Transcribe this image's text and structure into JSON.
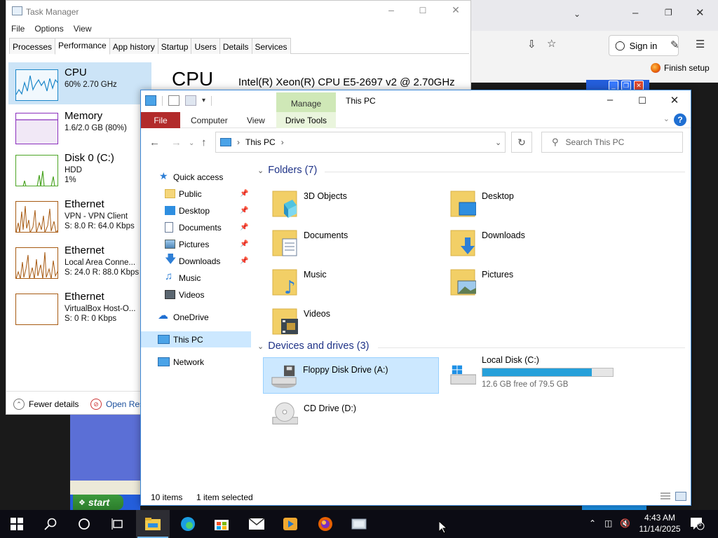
{
  "browser": {
    "sign_in": "Sign in",
    "finish_setup": "Finish setup"
  },
  "xp": {
    "start": "start"
  },
  "task_manager": {
    "title": "Task Manager",
    "menu": [
      "File",
      "Options",
      "View"
    ],
    "tabs": [
      "Processes",
      "Performance",
      "App history",
      "Startup",
      "Users",
      "Details",
      "Services"
    ],
    "active_tab": "Performance",
    "items": [
      {
        "name": "CPU",
        "lines": [
          "60%  2.70 GHz"
        ],
        "color": "#1c87c9",
        "selected": true
      },
      {
        "name": "Memory",
        "lines": [
          "1.6/2.0 GB (80%)"
        ],
        "color": "#8b2fbd",
        "selected": false
      },
      {
        "name": "Disk 0 (C:)",
        "lines": [
          "HDD",
          "1%"
        ],
        "color": "#4da526",
        "selected": false
      },
      {
        "name": "Ethernet",
        "lines": [
          "VPN - VPN Client",
          "S: 8.0  R: 64.0 Kbps"
        ],
        "color": "#a75a12",
        "selected": false
      },
      {
        "name": "Ethernet",
        "lines": [
          "Local Area Conne...",
          "S: 24.0  R: 88.0 Kbps"
        ],
        "color": "#a75a12",
        "selected": false
      },
      {
        "name": "Ethernet",
        "lines": [
          "VirtualBox Host-O...",
          "S: 0  R: 0 Kbps"
        ],
        "color": "#a75a12",
        "selected": false
      }
    ],
    "detail_title": "CPU",
    "cpu_model": "Intel(R) Xeon(R) CPU E5-2697 v2 @ 2.70GHz",
    "fewer_details": "Fewer details",
    "open_resource": "Open Res"
  },
  "explorer": {
    "title": "This PC",
    "manage_tab": "Manage",
    "ribbon_tabs": [
      "File",
      "Computer",
      "View"
    ],
    "drive_tools": "Drive Tools",
    "address": "This PC",
    "search_placeholder": "Search This PC",
    "nav": {
      "quick_access": "Quick access",
      "quick_items": [
        "Public",
        "Desktop",
        "Documents",
        "Pictures",
        "Downloads",
        "Music",
        "Videos"
      ],
      "onedrive": "OneDrive",
      "this_pc": "This PC",
      "network": "Network"
    },
    "folders_header": "Folders (7)",
    "folders": [
      "3D Objects",
      "Desktop",
      "Documents",
      "Downloads",
      "Music",
      "Pictures",
      "Videos"
    ],
    "devices_header": "Devices and drives (3)",
    "devices": [
      {
        "name": "Floppy Disk Drive (A:)",
        "selected": true
      },
      {
        "name": "Local Disk (C:)",
        "free": "12.6 GB free of 79.5 GB",
        "used_fraction": 0.84
      },
      {
        "name": "CD Drive (D:)"
      }
    ],
    "status_items": "10 items",
    "status_selected": "1 item selected"
  },
  "taskbar": {
    "time": "4:43 AM",
    "date": "11/14/2025",
    "notifications": "6"
  },
  "colors": {
    "selection": "#cce8ff",
    "accent": "#1f6fd2",
    "file_tab": "#b22b2b",
    "manage_tab": "#cfe8b7",
    "group_header": "#1e3287",
    "drive_fill": "#26a0da"
  }
}
